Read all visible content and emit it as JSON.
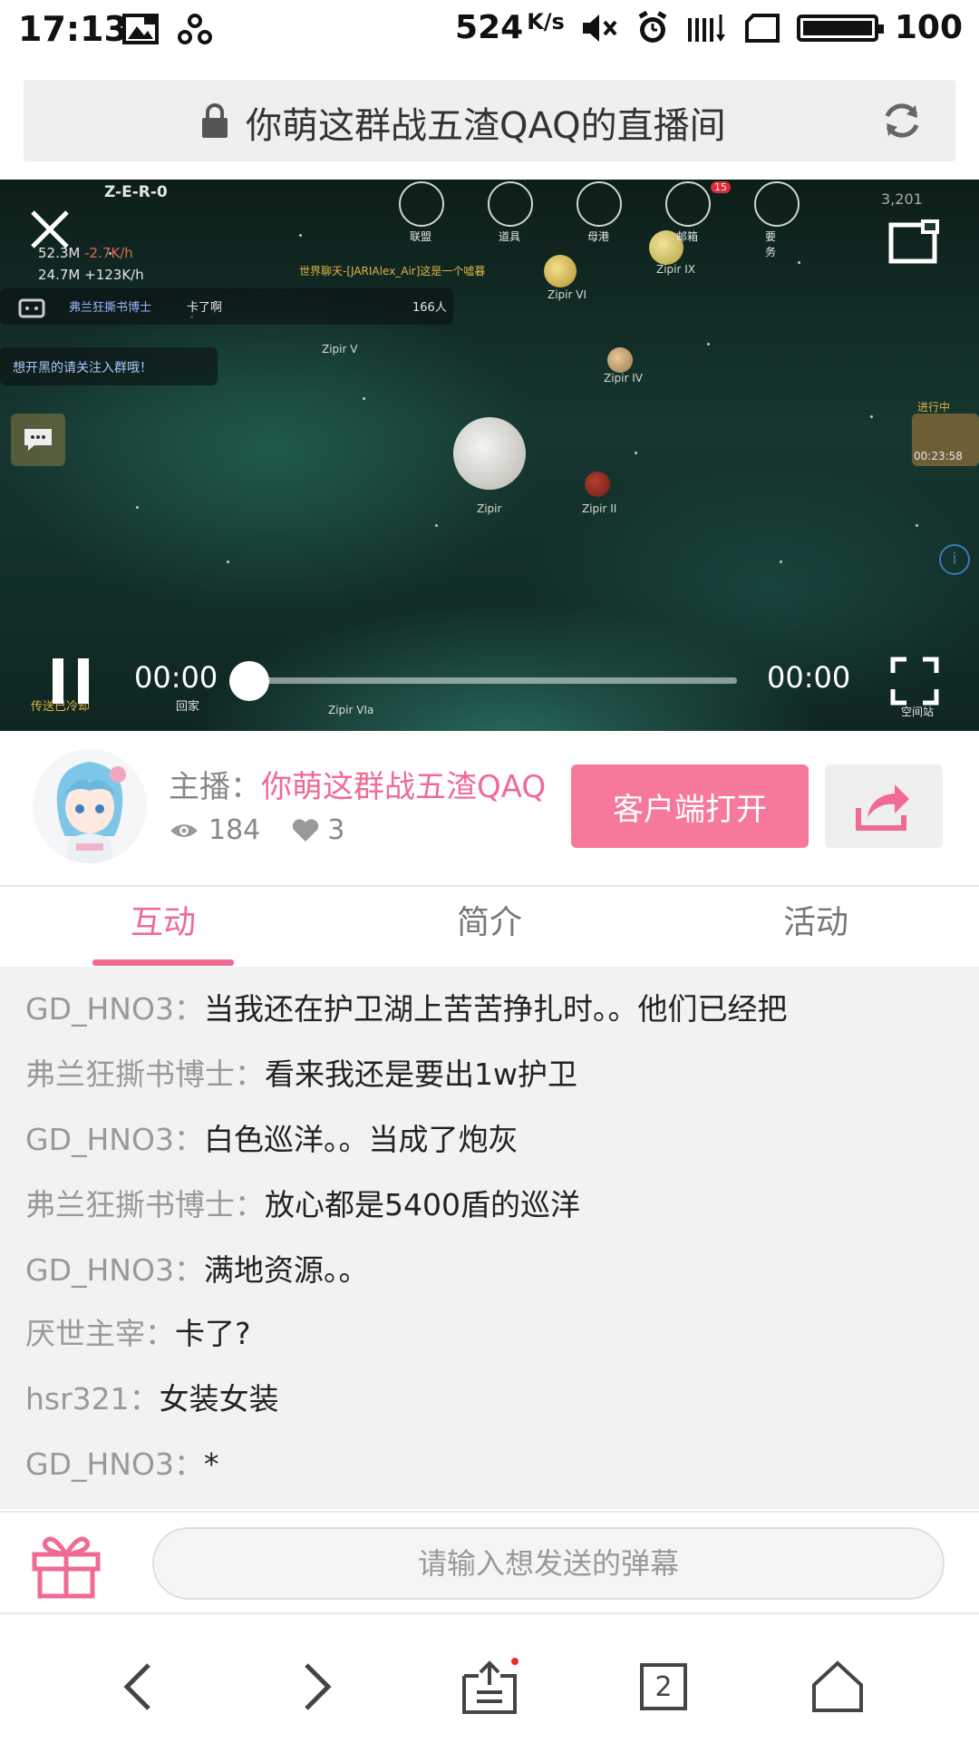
{
  "status_bar": {
    "time": "17:13",
    "net_speed": "524",
    "net_speed_unit": "K/s",
    "battery": "100"
  },
  "url_bar": {
    "title": "你萌这群战五渣QAQ的直播间"
  },
  "video": {
    "current_time": "00:00",
    "end_time": "00:00",
    "progress": 0,
    "hud": {
      "player_id": "Z-E-R-0",
      "resource_1": "52.3M",
      "resource_1_rate": "-2.7K/h",
      "resource_2": "24.7M",
      "resource_2_rate": "+123K/h",
      "chat_sender": "弗兰狂撕书博士",
      "chat_text": "卡了啊",
      "online_count": "166人",
      "notice": "想开黑的请关注入群哦！",
      "world_chat": "世界聊天-[JARIAlex_Air]这是一个嘘暮",
      "menu": [
        "联盟",
        "道具",
        "母港",
        "邮箱",
        "要务"
      ],
      "mail_badge": "15",
      "credits": "3,201",
      "timer_status": "进行中",
      "timer": "00:23:58",
      "bottom_left": "传送已冷却",
      "return_label": "回家",
      "station_label": "空间站",
      "planets": [
        "Zipir",
        "Zipir II",
        "Zipir IV",
        "Zipir V",
        "Zipir VI",
        "Zipir VIa",
        "Zipir IX"
      ]
    }
  },
  "anchor": {
    "label": "主播：",
    "name": "你萌这群战五渣QAQ",
    "views": "184",
    "likes": "3",
    "open_button": "客户端打开"
  },
  "tabs": [
    {
      "label": "互动",
      "active": true
    },
    {
      "label": "简介",
      "active": false
    },
    {
      "label": "活动",
      "active": false
    }
  ],
  "chat": [
    {
      "user": "GD_HNO3：",
      "text": "当我还在护卫湖上苦苦挣扎时。。他们已经把"
    },
    {
      "user": "弗兰狂撕书博士：",
      "text": "看来我还是要出1w护卫"
    },
    {
      "user": "GD_HNO3：",
      "text": "白色巡洋。。当成了炮灰"
    },
    {
      "user": "弗兰狂撕书博士：",
      "text": "放心都是5400盾的巡洋"
    },
    {
      "user": "GD_HNO3：",
      "text": "满地资源。。"
    },
    {
      "user": "厌世主宰：",
      "text": "卡了?"
    },
    {
      "user": "hsr321：",
      "text": "女装女装"
    },
    {
      "user": "GD_HNO3：",
      "text": "*"
    }
  ],
  "input": {
    "placeholder": "请输入想发送的弹幕"
  },
  "bottom_nav": {
    "tab_count": "2"
  },
  "colors": {
    "accent": "#f06b92",
    "button": "#f6799b"
  }
}
